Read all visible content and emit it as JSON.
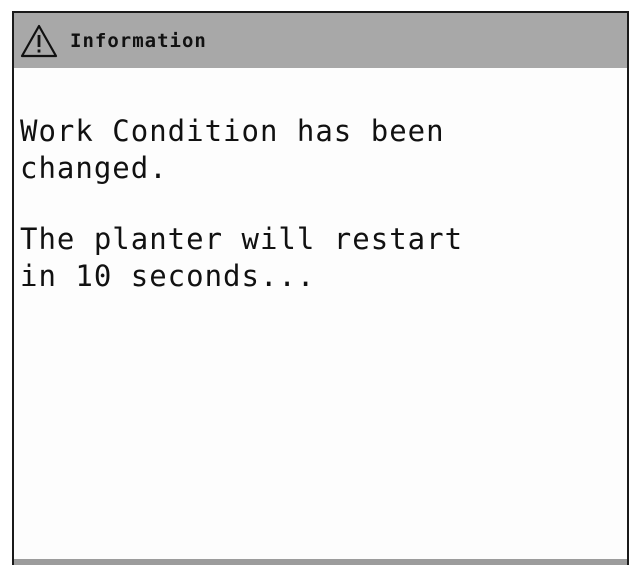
{
  "dialog": {
    "title": "Information",
    "title_icon": "warning-triangle-icon",
    "messages": [
      "Work Condition has been\nchanged.",
      "The planter will restart\nin 10 seconds..."
    ]
  },
  "colors": {
    "header_background": "#a8a8a8",
    "text": "#111111",
    "background": "#fdfdfd"
  }
}
